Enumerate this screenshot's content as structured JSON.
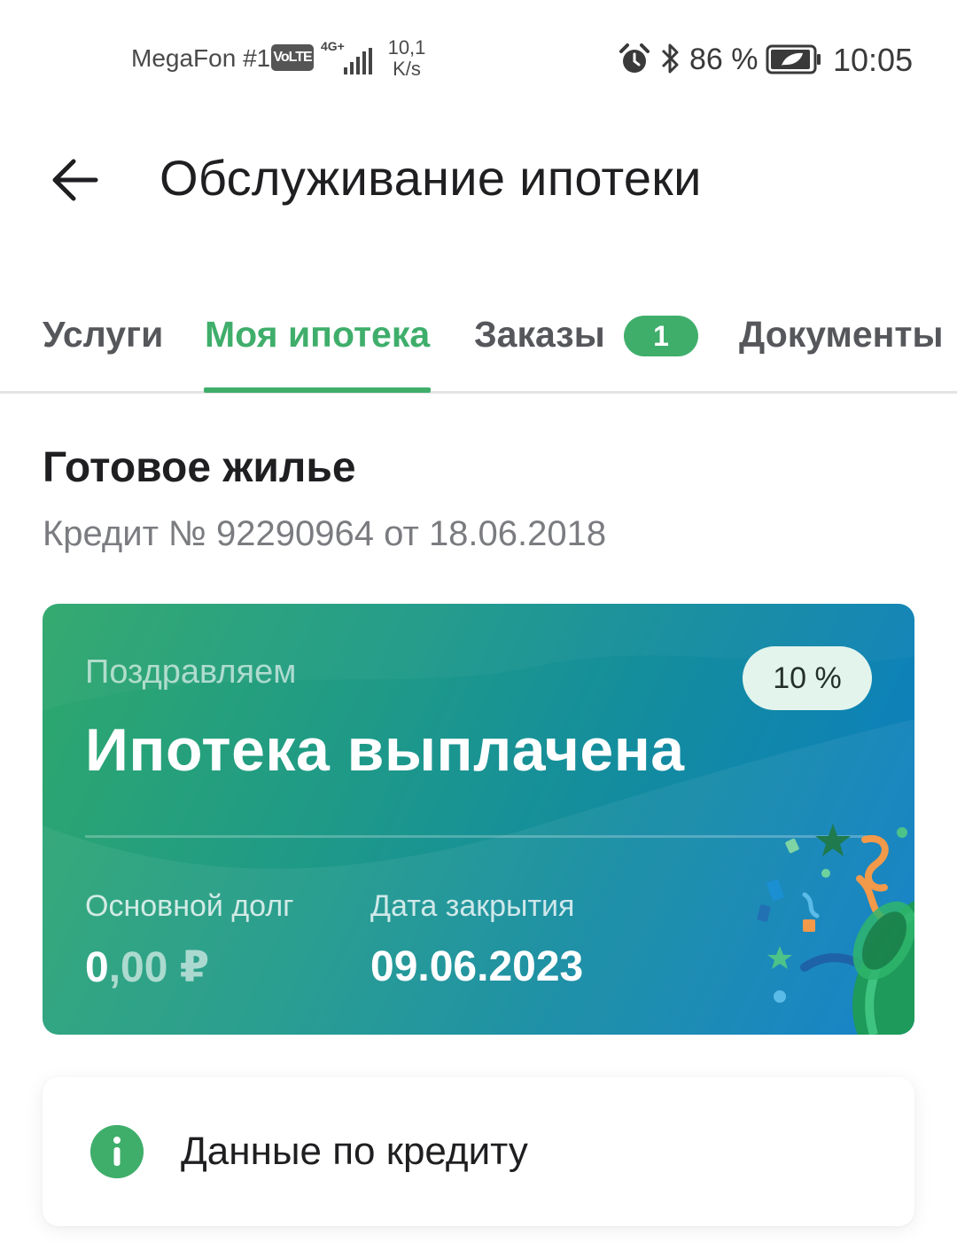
{
  "status_bar": {
    "carrier": "MegaFon #1",
    "volte": "VoLTE",
    "network": "4G+",
    "speed_value": "10,1",
    "speed_unit": "K/s",
    "battery_percent": "86 %",
    "time": "10:05"
  },
  "header": {
    "title": "Обслуживание ипотеки"
  },
  "tabs": {
    "items": [
      {
        "label": "Услуги"
      },
      {
        "label": "Моя ипотека"
      },
      {
        "label": "Заказы"
      },
      {
        "label": "Документы"
      }
    ],
    "active_index": 1,
    "orders_badge": "1"
  },
  "mortgage": {
    "title": "Готовое жилье",
    "credit_text": "Кредит № 92290964 от 18.06.2018"
  },
  "status_card": {
    "congrats": "Поздравляем",
    "percent": "10 %",
    "headline": "Ипотека выплачена",
    "debt_label": "Основной долг",
    "debt_value_int": "0",
    "debt_value_rest": ",00 ₽",
    "close_label": "Дата закрытия",
    "close_value": "09.06.2023"
  },
  "credit_data": {
    "label": "Данные по кредиту",
    "icon": "info-icon"
  },
  "colors": {
    "accent": "#3fae6b",
    "card_gradient_start": "#2fa86c",
    "card_gradient_end": "#0a7bc8",
    "text_primary": "#1f1f22",
    "text_secondary": "#7a7c80"
  }
}
